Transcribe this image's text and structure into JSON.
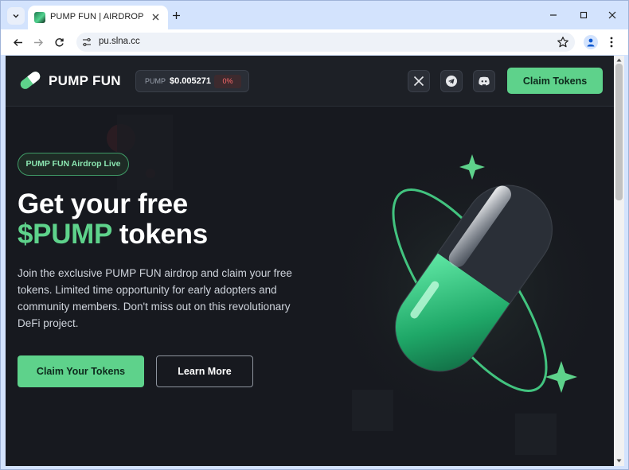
{
  "browser": {
    "tab_title": "PUMP FUN | AIRDROP",
    "url": "pu.slna.cc"
  },
  "site": {
    "brand": "PUMP FUN",
    "price": {
      "symbol": "PUMP",
      "value": "$0.005271",
      "change": "0%"
    },
    "social_icons": [
      "x-icon",
      "telegram-icon",
      "discord-icon"
    ],
    "header_button": "Claim Tokens"
  },
  "hero": {
    "badge": "PUMP FUN Airdrop Live",
    "headline_line1": "Get your free",
    "headline_accent": "$PUMP",
    "headline_rest": " tokens",
    "description": "Join the exclusive PUMP FUN airdrop and claim your free tokens. Limited time opportunity for early adopters and community members. Don't miss out on this revolutionary DeFi project.",
    "primary_button": "Claim Your Tokens",
    "secondary_button": "Learn More"
  },
  "colors": {
    "accent": "#5ed28b",
    "background": "#16181d",
    "header": "#1d2026",
    "negative": "#ff6b6b"
  }
}
